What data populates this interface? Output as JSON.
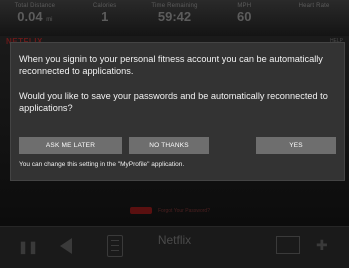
{
  "stats": [
    {
      "label": "Total Distance",
      "value": "0.04",
      "unit": "mi"
    },
    {
      "label": "Calories",
      "value": "1",
      "unit": ""
    },
    {
      "label": "Time Remaining",
      "value": "59:42",
      "unit": ""
    },
    {
      "label": "MPH",
      "value": "60",
      "unit": ""
    },
    {
      "label": "Heart Rate",
      "value": "",
      "unit": ""
    }
  ],
  "app": {
    "logo": "NETFLIX",
    "help": "HELP",
    "forgot_password": "Forgot Your Password?"
  },
  "dialog": {
    "message1": "When you signin to your personal fitness account you can be automatically reconnected to applications.",
    "message2": "Would you like to save your passwords and be automatically reconnected to applications?",
    "buttons": {
      "ask_later": "ASK ME LATER",
      "no_thanks": "NO THANKS",
      "yes": "YES"
    },
    "note": "You can change this setting in the \"MyProfile\" application."
  },
  "bottom_bar": {
    "title": "Netflix"
  },
  "icons": [
    "pause-icon",
    "back-icon",
    "menu-icon",
    "screens-icon",
    "directional-pad-icon"
  ]
}
